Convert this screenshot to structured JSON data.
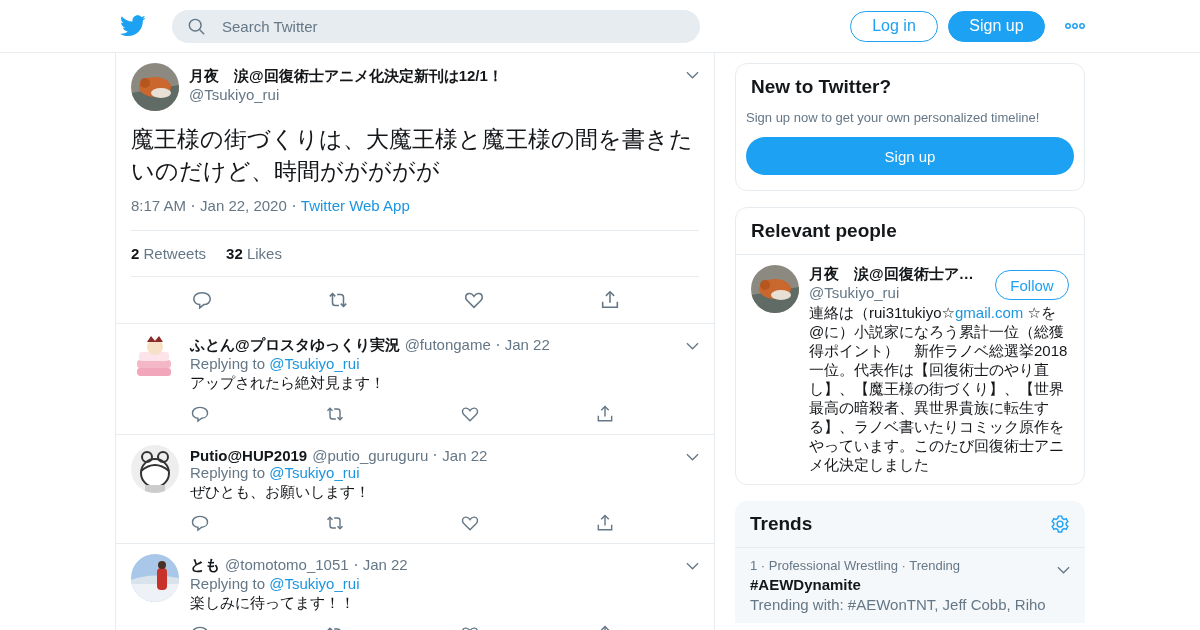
{
  "header": {
    "search": {
      "placeholder": "Search Twitter"
    },
    "login": "Log in",
    "signup": "Sign up"
  },
  "tweet": {
    "name": "月夜　涙@回復術士アニメ化決定新刊は12/1！",
    "handle": "@Tsukiyo_rui",
    "text": "魔王様の街づくりは、大魔王様と魔王様の間を書きたいのだけど、時間ががががが",
    "time": "8:17 AM",
    "date": "Jan 22, 2020",
    "source": "Twitter Web App",
    "retweets": "2",
    "retweets_label": "Retweets",
    "likes": "32",
    "likes_label": "Likes"
  },
  "replies": [
    {
      "name": "ふとん@プロスタゆっくり実況",
      "handle": "@futongame",
      "date": "Jan 22",
      "replying_label": "Replying to",
      "replying_to": "@Tsukiyo_rui",
      "text": "アップされたら絶対見ます！"
    },
    {
      "name": "Putio@HUP2019",
      "handle": "@putio_guruguru",
      "date": "Jan 22",
      "replying_label": "Replying to",
      "replying_to": "@Tsukiyo_rui",
      "text": "ぜひとも、お願いします！"
    },
    {
      "name": "とも",
      "handle": "@tomotomo_1051",
      "date": "Jan 22",
      "replying_label": "Replying to",
      "replying_to": "@Tsukiyo_rui",
      "text": "楽しみに待ってます！！"
    }
  ],
  "signup_card": {
    "title": "New to Twitter?",
    "text": "Sign up now to get your own personalized timeline!",
    "button": "Sign up"
  },
  "relevant_people": {
    "title": "Relevant people",
    "person": {
      "name": "月夜　涙@回復術士ア…",
      "handle": "@Tsukiyo_rui",
      "follow": "Follow",
      "bio_before": "連絡は（rui31tukiyo☆",
      "bio_link": "gmail.com",
      "bio_after": " ☆を@に）小説家になろう累計一位（総獲得ポイント）　新作ラノベ総選挙2018一位。代表作は【回復術士のやり直し】、【魔王様の街づくり】、【世界最高の暗殺者、異世界貴族に転生する】、ラノベ書いたりコミック原作をやっています。このたび回復術士アニメ化決定しました"
    }
  },
  "trends": {
    "title": "Trends",
    "items": [
      {
        "meta": "1 · Professional Wrestling · Trending",
        "name": "#AEWDynamite",
        "with": "Trending with: #AEWonTNT, Jeff Cobb, Riho"
      }
    ]
  }
}
